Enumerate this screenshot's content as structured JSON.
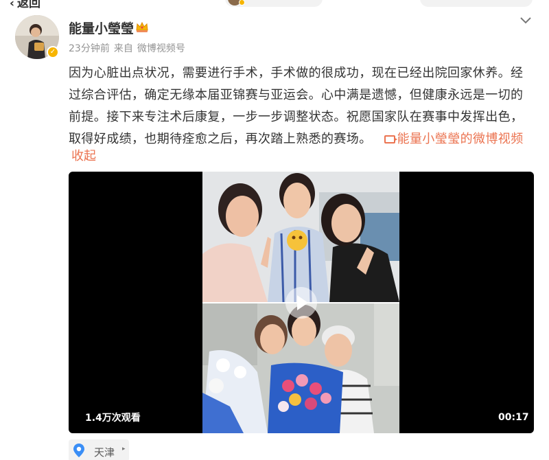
{
  "nav": {
    "back_label": "返回"
  },
  "post": {
    "author": "能量小瑩瑩",
    "time": "23分钟前",
    "source_prefix": "来自",
    "source": "微博视频号",
    "text": "因为心脏出点状况，需要进行手术，手术做的很成功，现在已经出院回家休养。经过综合评估，确定无缘本届亚锦赛与亚运会。心中满是遗憾，但健康永远是一切的前提。接下来专注术后康复，一步一步调整状态。祝愿国家队在赛事中发挥出色，取得好成绩，也期待痊愈之后，再次踏上熟悉的赛场。",
    "video_link": "能量小瑩瑩的微博视频",
    "collapse_label": "收起"
  },
  "video": {
    "views": "1.4万次观看",
    "duration": "00:17"
  },
  "location": {
    "label": "天津"
  },
  "icons": {
    "verified": "verified-badge-icon",
    "crown": "crown-icon",
    "chevron": "chevron-down-icon",
    "video": "video-icon",
    "play": "play-icon",
    "pin": "location-pin-icon"
  },
  "colors": {
    "link": "#eb7350",
    "verified": "#f7b500",
    "location": "#3a8ef6"
  }
}
